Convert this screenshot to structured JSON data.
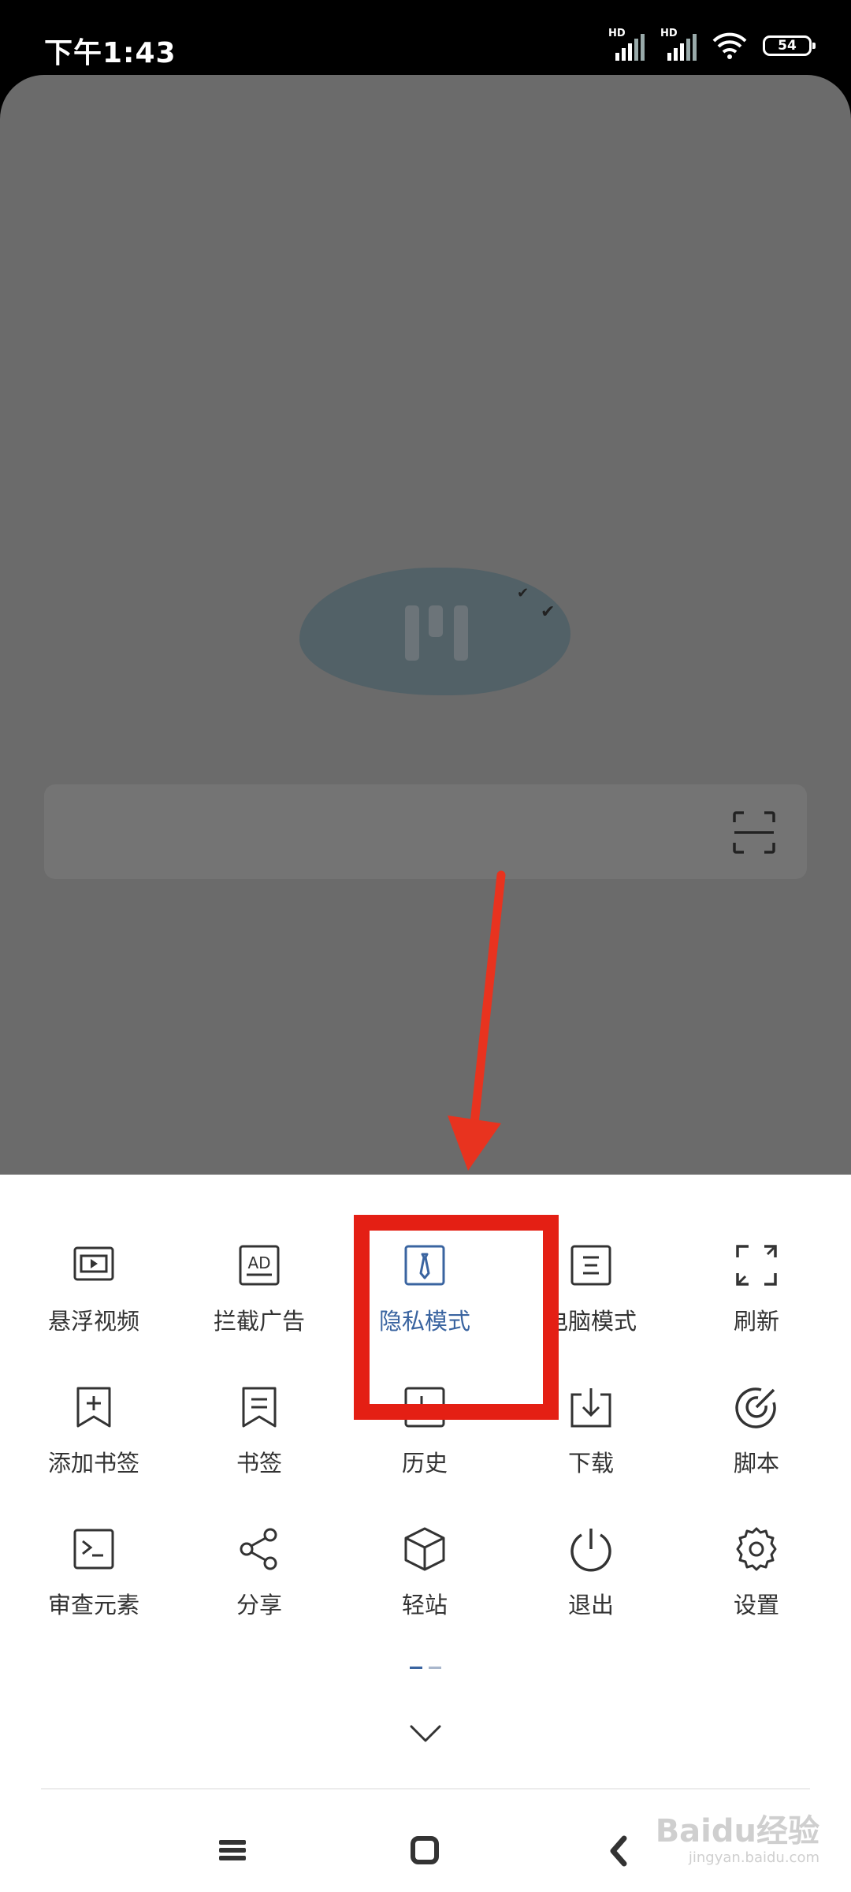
{
  "status_bar": {
    "time": "下午1:43",
    "signal1_label": "HD",
    "signal2_label": "HD",
    "battery": "54"
  },
  "page": {
    "bg_color": "#6b6b6b"
  },
  "menu": {
    "rows": [
      [
        {
          "label": "悬浮视频",
          "icon": "floating-video-icon"
        },
        {
          "label": "拦截广告",
          "icon": "ad-block-icon"
        },
        {
          "label": "隐私模式",
          "icon": "privacy-mode-icon",
          "active": true
        },
        {
          "label": "电脑模式",
          "icon": "desktop-mode-icon"
        },
        {
          "label": "刷新",
          "icon": "refresh-icon"
        }
      ],
      [
        {
          "label": "添加书签",
          "icon": "add-bookmark-icon"
        },
        {
          "label": "书签",
          "icon": "bookmarks-icon"
        },
        {
          "label": "历史",
          "icon": "history-icon"
        },
        {
          "label": "下载",
          "icon": "download-icon"
        },
        {
          "label": "脚本",
          "icon": "script-icon"
        }
      ],
      [
        {
          "label": "审查元素",
          "icon": "inspect-element-icon"
        },
        {
          "label": "分享",
          "icon": "share-icon"
        },
        {
          "label": "轻站",
          "icon": "light-site-icon"
        },
        {
          "label": "退出",
          "icon": "power-icon"
        },
        {
          "label": "设置",
          "icon": "gear-icon"
        }
      ]
    ],
    "page_indicator": {
      "current": 1,
      "total": 2
    },
    "accent_color": "#3a64a0",
    "highlight_color": "#e41f14"
  },
  "navbar": {
    "buttons": [
      "menu-icon",
      "home-icon",
      "back-icon"
    ]
  },
  "watermark": {
    "main": "Baidu经验",
    "sub": "jingyan.baidu.com"
  }
}
